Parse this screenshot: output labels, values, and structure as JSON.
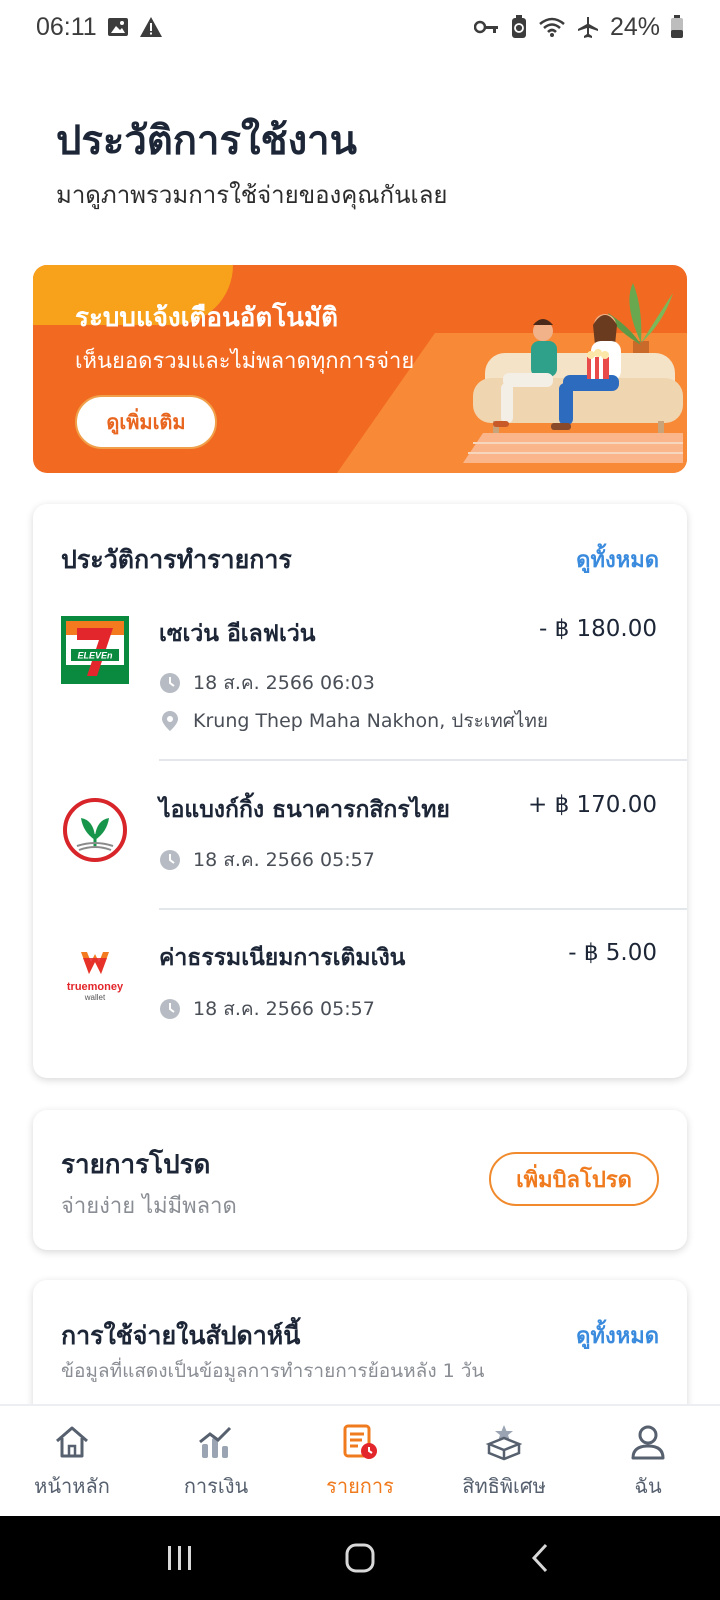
{
  "status_bar": {
    "time": "06:11",
    "battery": "24%",
    "icons": [
      "image-icon",
      "warning-icon",
      "key-icon",
      "battery-saver-icon",
      "wifi-icon",
      "airplane-icon",
      "battery-icon"
    ]
  },
  "header": {
    "title": "ประวัติการใช้งาน",
    "subtitle": "มาดูภาพรวมการใช้จ่ายของคุณกันเลย"
  },
  "banner": {
    "title": "ระบบแจ้งเตือนอัตโนมัติ",
    "text": "เห็นยอดรวมและไม่พลาดทุกการจ่าย",
    "button_label": "ดูเพิ่มเติม"
  },
  "transactions": {
    "title": "ประวัติการทำรายการ",
    "view_all": "ดูทั้งหมด",
    "items": [
      {
        "name": "เซเว่น อีเลฟเว่น",
        "amount": "- ฿ 180.00",
        "datetime": "18 ส.ค. 2566 06:03",
        "location": "Krung Thep Maha Nakhon, ประเทศไทย",
        "logo": "seven-eleven-logo"
      },
      {
        "name": "ไอแบงก์กิ้ง  ธนาคารกสิกรไทย",
        "amount": "+ ฿ 170.00",
        "datetime": "18 ส.ค. 2566 05:57",
        "logo": "kasikorn-bank-logo"
      },
      {
        "name": "ค่าธรรมเนียมการเติมเงิน",
        "amount": "- ฿ 5.00",
        "datetime": "18 ส.ค. 2566 05:57",
        "logo": "truemoney-wallet-logo",
        "logo_text": "truemoney",
        "logo_subtext": "wallet"
      }
    ]
  },
  "favorites": {
    "title": "รายการโปรด",
    "subtitle": "จ่ายง่าย ไม่มีพลาด",
    "button_label": "เพิ่มบิลโปรด"
  },
  "weekly": {
    "title": "การใช้จ่ายในสัปดาห์นี้",
    "view_all": "ดูทั้งหมด",
    "subtitle": "ข้อมูลที่แสดงเป็นข้อมูลการทำรายการย้อนหลัง 1 วัน"
  },
  "bottom_nav": {
    "items": [
      {
        "label": "หน้าหลัก",
        "icon": "home-icon"
      },
      {
        "label": "การเงิน",
        "icon": "finance-chart-icon"
      },
      {
        "label": "รายการ",
        "icon": "transactions-icon",
        "active": true
      },
      {
        "label": "สิทธิพิเศษ",
        "icon": "privileges-gift-icon"
      },
      {
        "label": "ฉัน",
        "icon": "profile-icon"
      }
    ]
  },
  "colors": {
    "accent": "#f07b1f",
    "link": "#3a8bde",
    "banner": "#f26a21"
  }
}
